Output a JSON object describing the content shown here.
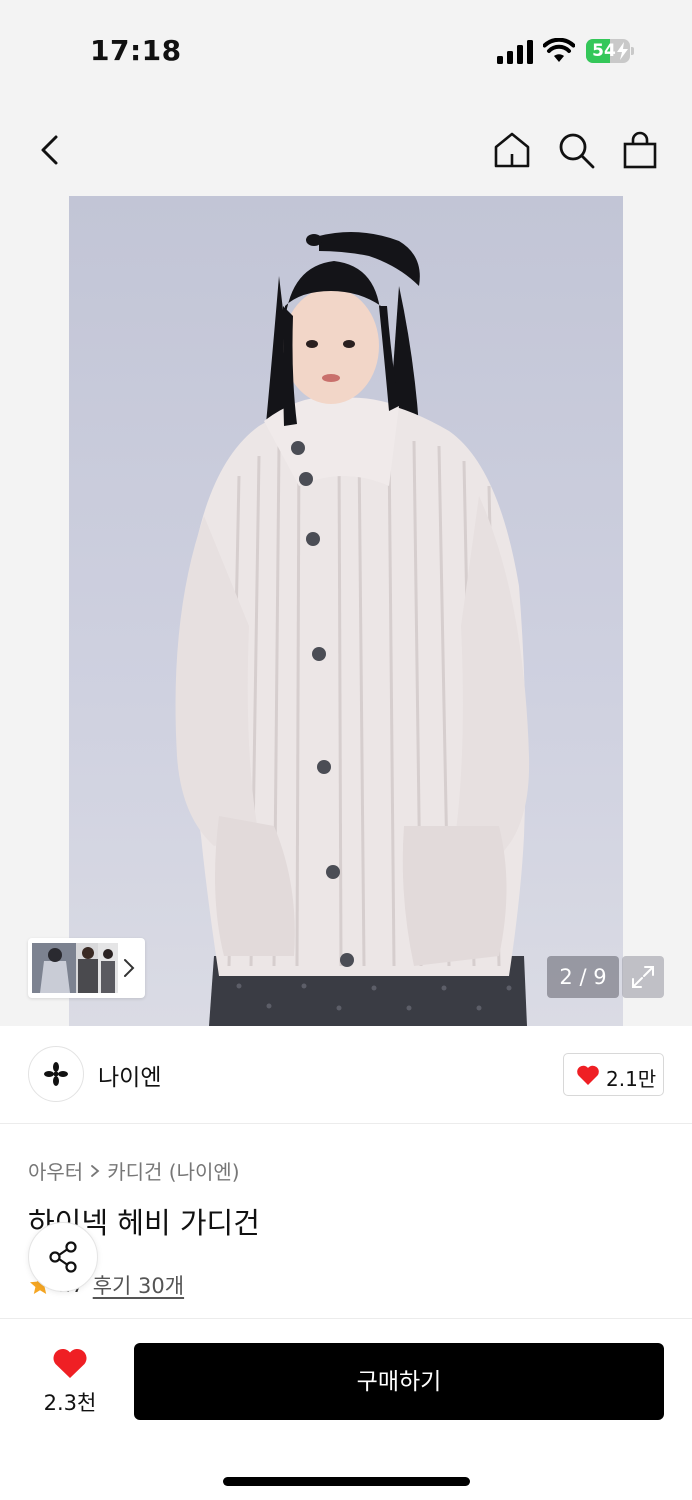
{
  "status": {
    "time": "17:18",
    "battery": "54",
    "battery_level": 0.54
  },
  "nav": {
    "icons": [
      "back-icon",
      "home-icon",
      "search-icon",
      "shopping-bag-icon"
    ]
  },
  "gallery": {
    "counter": "2 / 9"
  },
  "brand": {
    "name": "나이엔",
    "likes": "2.1만"
  },
  "product": {
    "breadcrumb": [
      "아우터",
      "카디건 (나이엔)"
    ],
    "title": "하이넥 헤비 가디건",
    "rating_partial": "..7",
    "reviews": "후기 30개"
  },
  "bottom": {
    "like_count": "2.3천",
    "buy_label": "구매하기"
  },
  "colors": {
    "accent": "#ef1f24",
    "star": "#f5a623",
    "battery_fill": "#34c759",
    "buy_button": "#000000"
  }
}
